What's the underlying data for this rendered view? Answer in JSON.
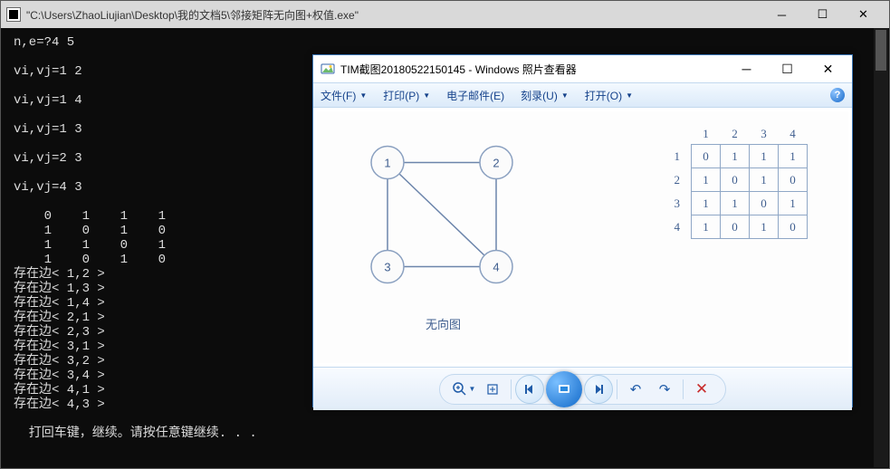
{
  "console": {
    "title_prefix": "",
    "title": "\"C:\\Users\\ZhaoLiujian\\Desktop\\我的文档5\\邻接矩阵无向图+权值.exe\"",
    "body": "n,e=?4 5\n\nvi,vj=1 2\n\nvi,vj=1 4\n\nvi,vj=1 3\n\nvi,vj=2 3\n\nvi,vj=4 3\n\n    0    1    1    1\n    1    0    1    0\n    1    1    0    1\n    1    0    1    0\n存在边< 1,2 >\n存在边< 1,3 >\n存在边< 1,4 >\n存在边< 2,1 >\n存在边< 2,3 >\n存在边< 3,1 >\n存在边< 3,2 >\n存在边< 3,4 >\n存在边< 4,1 >\n存在边< 4,3 >\n\n  打回车键，继续。请按任意键继续. . ."
  },
  "viewer": {
    "title": "TIM截图20180522150145 - Windows 照片查看器",
    "menu": {
      "file": "文件(F)",
      "print": "打印(P)",
      "email": "电子邮件(E)",
      "burn": "刻录(U)",
      "open": "打开(O)"
    },
    "help": "?",
    "caption": "无向图",
    "graph": {
      "nodes": [
        "1",
        "2",
        "3",
        "4"
      ]
    },
    "matrix": {
      "headers": [
        "1",
        "2",
        "3",
        "4"
      ],
      "rows": [
        {
          "h": "1",
          "v": [
            "0",
            "1",
            "1",
            "1"
          ]
        },
        {
          "h": "2",
          "v": [
            "1",
            "0",
            "1",
            "0"
          ]
        },
        {
          "h": "3",
          "v": [
            "1",
            "1",
            "0",
            "1"
          ]
        },
        {
          "h": "4",
          "v": [
            "1",
            "0",
            "1",
            "0"
          ]
        }
      ]
    }
  },
  "chart_data": {
    "type": "table",
    "title": "邻接矩阵 / 无向图",
    "categories": [
      "1",
      "2",
      "3",
      "4"
    ],
    "series": [
      {
        "name": "1",
        "values": [
          0,
          1,
          1,
          1
        ]
      },
      {
        "name": "2",
        "values": [
          1,
          0,
          1,
          0
        ]
      },
      {
        "name": "3",
        "values": [
          1,
          1,
          0,
          1
        ]
      },
      {
        "name": "4",
        "values": [
          1,
          0,
          1,
          0
        ]
      }
    ],
    "edges": [
      [
        1,
        2
      ],
      [
        1,
        3
      ],
      [
        1,
        4
      ],
      [
        2,
        3
      ],
      [
        3,
        4
      ]
    ]
  }
}
